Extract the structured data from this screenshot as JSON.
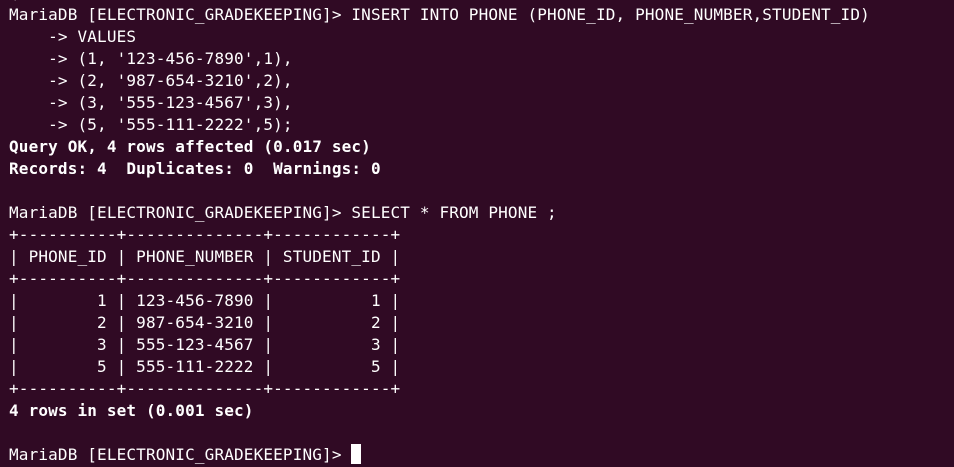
{
  "terminal": {
    "partial_top": "(",
    "lines": [
      {
        "text": "MariaDB [ELECTRONIC_GRADEKEEPING]> INSERT INTO PHONE (PHONE_ID, PHONE_NUMBER,STUDENT_ID)",
        "bold": false
      },
      {
        "text": "    -> VALUES",
        "bold": false
      },
      {
        "text": "    -> (1, '123-456-7890',1),",
        "bold": false
      },
      {
        "text": "    -> (2, '987-654-3210',2),",
        "bold": false
      },
      {
        "text": "    -> (3, '555-123-4567',3),",
        "bold": false
      },
      {
        "text": "    -> (5, '555-111-2222',5);",
        "bold": false
      },
      {
        "text": "Query OK, 4 rows affected (0.017 sec)",
        "bold": true
      },
      {
        "text": "Records: 4  Duplicates: 0  Warnings: 0",
        "bold": true
      },
      {
        "text": "",
        "bold": false
      },
      {
        "text": "MariaDB [ELECTRONIC_GRADEKEEPING]> SELECT * FROM PHONE ;",
        "bold": false
      },
      {
        "text": "+----------+--------------+------------+",
        "bold": false
      },
      {
        "text": "| PHONE_ID | PHONE_NUMBER | STUDENT_ID |",
        "bold": false
      },
      {
        "text": "+----------+--------------+------------+",
        "bold": false
      },
      {
        "text": "|        1 | 123-456-7890 |          1 |",
        "bold": false
      },
      {
        "text": "|        2 | 987-654-3210 |          2 |",
        "bold": false
      },
      {
        "text": "|        3 | 555-123-4567 |          3 |",
        "bold": false
      },
      {
        "text": "|        5 | 555-111-2222 |          5 |",
        "bold": false
      },
      {
        "text": "+----------+--------------+------------+",
        "bold": false
      },
      {
        "text": "4 rows in set (0.001 sec)",
        "bold": true
      },
      {
        "text": "",
        "bold": false
      }
    ],
    "prompt": "MariaDB [ELECTRONIC_GRADEKEEPING]> ",
    "colors": {
      "background": "#300a24",
      "foreground": "#ffffff"
    }
  }
}
